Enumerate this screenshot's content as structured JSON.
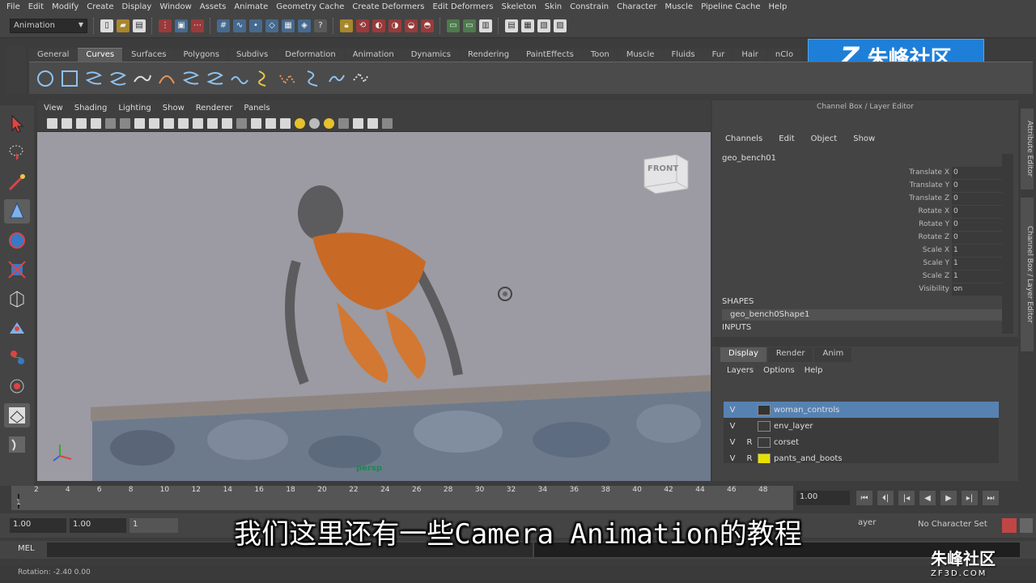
{
  "menubar": [
    "File",
    "Edit",
    "Modify",
    "Create",
    "Display",
    "Window",
    "Assets",
    "Animate",
    "Geometry Cache",
    "Create Deformers",
    "Edit Deformers",
    "Skeleton",
    "Skin",
    "Constrain",
    "Character",
    "Muscle",
    "Pipeline Cache",
    "Help"
  ],
  "status": {
    "mode": "Animation"
  },
  "shelf_tabs": [
    "General",
    "Curves",
    "Surfaces",
    "Polygons",
    "Subdivs",
    "Deformation",
    "Animation",
    "Dynamics",
    "Rendering",
    "PaintEffects",
    "Toon",
    "Muscle",
    "Fluids",
    "Fur",
    "Hair",
    "nClo"
  ],
  "shelf_active": "Curves",
  "logo": {
    "mark": "Z",
    "text": "朱峰社区"
  },
  "viewport": {
    "menu": [
      "View",
      "Shading",
      "Lighting",
      "Show",
      "Renderer",
      "Panels"
    ],
    "camera_label": "persp",
    "viewcube_label": "FRONT"
  },
  "channelbox": {
    "title": "Channel Box / Layer Editor",
    "menu": [
      "Channels",
      "Edit",
      "Object",
      "Show"
    ],
    "object": "geo_bench01",
    "channels": [
      {
        "label": "Translate X",
        "value": "0"
      },
      {
        "label": "Translate Y",
        "value": "0"
      },
      {
        "label": "Translate Z",
        "value": "0"
      },
      {
        "label": "Rotate X",
        "value": "0"
      },
      {
        "label": "Rotate Y",
        "value": "0"
      },
      {
        "label": "Rotate Z",
        "value": "0"
      },
      {
        "label": "Scale X",
        "value": "1"
      },
      {
        "label": "Scale Y",
        "value": "1"
      },
      {
        "label": "Scale Z",
        "value": "1"
      },
      {
        "label": "Visibility",
        "value": "on"
      }
    ],
    "shapes_header": "SHAPES",
    "shape_name": "geo_bench0Shape1",
    "inputs_header": "INPUTS"
  },
  "side_tabs": [
    "Attribute Editor",
    "Channel Box / Layer Editor"
  ],
  "layers": {
    "tabs": [
      "Display",
      "Render",
      "Anim"
    ],
    "menu": [
      "Layers",
      "Options",
      "Help"
    ],
    "rows": [
      {
        "v": "V",
        "r": "",
        "name": "woman_controls",
        "color": "#333333",
        "selected": true
      },
      {
        "v": "V",
        "r": "",
        "name": "env_layer",
        "color": "",
        "selected": false
      },
      {
        "v": "V",
        "r": "R",
        "name": "corset",
        "color": "",
        "selected": false
      },
      {
        "v": "V",
        "r": "R",
        "name": "pants_and_boots",
        "color": "#e8e000",
        "selected": false
      }
    ]
  },
  "timeline": {
    "ticks": [
      "2",
      "4",
      "6",
      "8",
      "10",
      "12",
      "14",
      "16",
      "18",
      "20",
      "22",
      "24",
      "26",
      "28",
      "30",
      "32",
      "34",
      "36",
      "38",
      "40",
      "42",
      "44",
      "46",
      "48"
    ],
    "current_frame": "1",
    "frame_field": "1.00"
  },
  "range": {
    "start": "1.00",
    "start2": "1.00",
    "inner": "1",
    "layer_label": "ayer",
    "character_set": "No Character Set"
  },
  "mel": {
    "label": "MEL"
  },
  "helpline": {
    "text": "Rotation:  -2.40      0.00"
  },
  "subtitle": "我们这里还有一些Camera Animation的教程",
  "watermark": {
    "text": "朱峰社区",
    "url": "ZF3D.COM"
  }
}
